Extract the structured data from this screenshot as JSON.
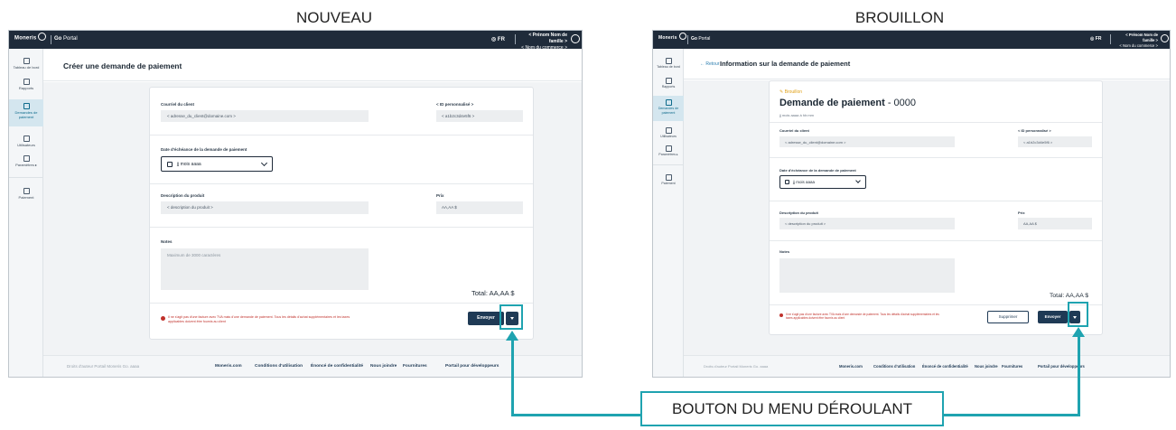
{
  "captions": {
    "left": "NOUVEAU",
    "right": "BROUILLON"
  },
  "callout": "BOUTON DU MENU DÉROULANT",
  "topbar": {
    "brand": "Moneris",
    "product_bold": "Go",
    "product_rest": " Portal",
    "lang": "FR",
    "user_name": "< Prénom Nom de famille >",
    "user_store": "< Nom du commerce >"
  },
  "sidebar": [
    {
      "label": "Tableau de bord",
      "icon": "dashboard-icon"
    },
    {
      "label": "Rapports",
      "icon": "reports-icon"
    },
    {
      "label": "Demandes de paiement",
      "icon": "payment-requests-icon"
    },
    {
      "label": "Utilisateurs",
      "icon": "users-icon"
    },
    {
      "label": "Paramètres ▸",
      "icon": "settings-icon"
    },
    {
      "label": "Paiement",
      "icon": "payment-icon"
    }
  ],
  "new_form": {
    "title": "Créer une demande de paiement",
    "email_label": "Courriel du client",
    "email_value": "< adresse_du_client@domaine.com >",
    "id_label": "< ID personnalisé >",
    "id_value": "< a1b2c3d4e5f6 >",
    "due_label": "Date d'échéance de la demande de paiement",
    "due_value": "jj mois aaaa",
    "desc_label": "Description du produit",
    "desc_value": "< description du produit >",
    "price_label": "Prix",
    "price_value": "AA,AA $",
    "notes_label": "Notes",
    "notes_placeholder": "Maximum de 3000 caractères",
    "total": "Total: AA,AA  $",
    "warning": "Il ne s'agit pas d'une facture avec TVA mais d'une demande de paiement. Tous les détails d'achat supplémentaires et les taxes applicables doivent être fournis au client",
    "send_label": "Envoyer"
  },
  "draft_form": {
    "back": "← Retour",
    "title": "Information sur la demande de paiement",
    "status": "✎ Brouillon",
    "heading_bold": "Demande de paiement",
    "heading_number": " - 0000",
    "date_sub": "jj mois aaaa à hh:mm",
    "email_label": "Courriel du client",
    "email_value": "< adresse_du_client@domaine.com >",
    "id_label": "< ID personnalisé >",
    "id_value": "< a1b2c3d4e5f6 >",
    "due_label": "Date d'échéance de la demande de paiement",
    "due_value": "jj mois aaaa",
    "desc_label": "Description du produit",
    "desc_value": "< description du produit >",
    "price_label": "Prix",
    "price_value": "AA,AA $",
    "notes_label": "Notes",
    "total": "Total: AA,AA  $",
    "warning": "Il ne s'agit pas d'une facture avec TVA mais d'une demande de paiement. Tous les détails d'achat supplémentaires et les taxes applicables doivent être fournis au client",
    "delete_label": "Supprimer",
    "send_label": "Envoyer"
  },
  "footer": {
    "copyright": "Droits d'auteur Portail Moneris Go. aaaa",
    "links": [
      "Moneris.com",
      "Conditions d'utilisation",
      "Énoncé de confidentialité",
      "Nous joindre",
      "Fournitures",
      "Portail pour développeurs"
    ]
  },
  "colors": {
    "topbar": "#1f2b3a",
    "accent": "#1fa3b0",
    "warning": "#c0312b",
    "primary_button": "#1f3a55"
  }
}
